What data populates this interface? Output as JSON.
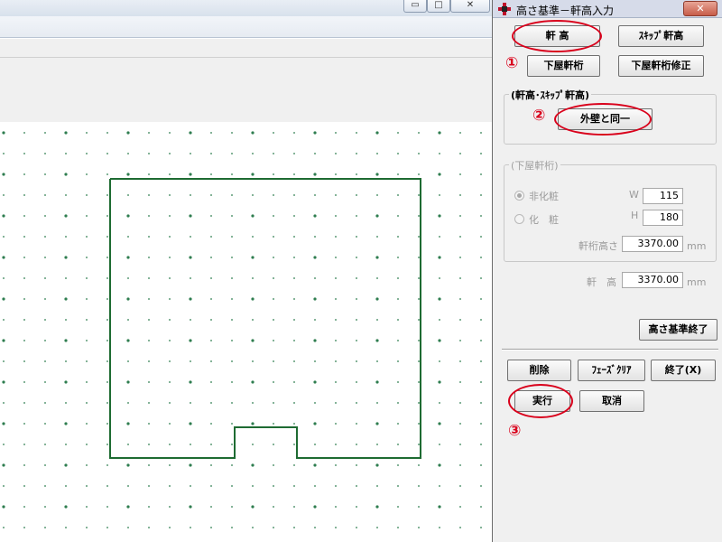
{
  "dialog": {
    "title": "高さ基準－軒高入力",
    "close_symbol": "✕",
    "buttons": {
      "noki": "軒 高",
      "skip_noki": "ｽｷｯﾌﾟ軒高",
      "geya_noki": "下屋軒桁",
      "geya_noki_fix": "下屋軒桁修正",
      "same_as_wall": "外壁と同一",
      "end_height": "高さ基準終了",
      "delete": "削除",
      "phase_clear": "ﾌｪｰｽﾞｸﾘｱ",
      "close": "終了(X)",
      "execute": "実行",
      "cancel": "取消"
    },
    "group_noki": {
      "label": "(軒高･ｽｷｯﾌﾟ軒高)"
    },
    "group_geya": {
      "label": "(下屋軒桁)",
      "radio_non_facing": "非化粧",
      "radio_facing": "化　粧",
      "w_label": "W",
      "w_value": "115",
      "h_label": "H",
      "h_value": "180",
      "height_label": "軒桁高さ",
      "height_value": "3370.00",
      "height_unit": "mm"
    },
    "noki_label": "軒　高",
    "noki_value": "3370.00",
    "noki_unit": "mm"
  },
  "annotations": {
    "step1": "①",
    "step2": "②",
    "step3": "③",
    "color": "#d9001b"
  },
  "main_window": {
    "minimize": "▭",
    "maximize": "□",
    "close": "✕"
  },
  "canvas": {
    "grid_color": "#2e7d4f",
    "outline_color": "#1e6b32"
  }
}
